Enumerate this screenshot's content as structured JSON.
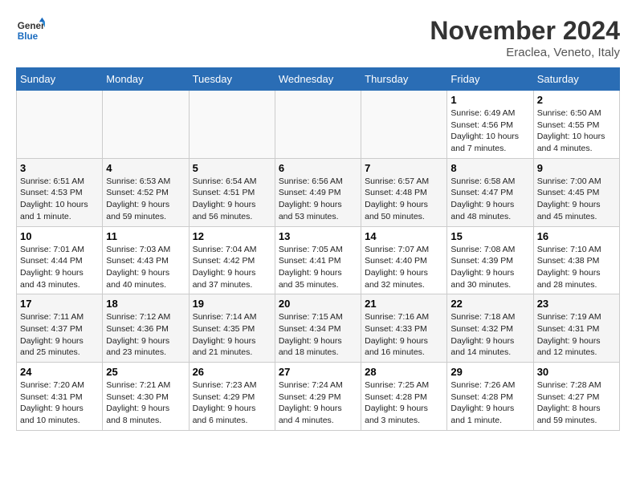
{
  "logo": {
    "line1": "General",
    "line2": "Blue"
  },
  "title": "November 2024",
  "location": "Eraclea, Veneto, Italy",
  "weekdays": [
    "Sunday",
    "Monday",
    "Tuesday",
    "Wednesday",
    "Thursday",
    "Friday",
    "Saturday"
  ],
  "weeks": [
    [
      {
        "day": "",
        "info": ""
      },
      {
        "day": "",
        "info": ""
      },
      {
        "day": "",
        "info": ""
      },
      {
        "day": "",
        "info": ""
      },
      {
        "day": "",
        "info": ""
      },
      {
        "day": "1",
        "info": "Sunrise: 6:49 AM\nSunset: 4:56 PM\nDaylight: 10 hours\nand 7 minutes."
      },
      {
        "day": "2",
        "info": "Sunrise: 6:50 AM\nSunset: 4:55 PM\nDaylight: 10 hours\nand 4 minutes."
      }
    ],
    [
      {
        "day": "3",
        "info": "Sunrise: 6:51 AM\nSunset: 4:53 PM\nDaylight: 10 hours\nand 1 minute."
      },
      {
        "day": "4",
        "info": "Sunrise: 6:53 AM\nSunset: 4:52 PM\nDaylight: 9 hours\nand 59 minutes."
      },
      {
        "day": "5",
        "info": "Sunrise: 6:54 AM\nSunset: 4:51 PM\nDaylight: 9 hours\nand 56 minutes."
      },
      {
        "day": "6",
        "info": "Sunrise: 6:56 AM\nSunset: 4:49 PM\nDaylight: 9 hours\nand 53 minutes."
      },
      {
        "day": "7",
        "info": "Sunrise: 6:57 AM\nSunset: 4:48 PM\nDaylight: 9 hours\nand 50 minutes."
      },
      {
        "day": "8",
        "info": "Sunrise: 6:58 AM\nSunset: 4:47 PM\nDaylight: 9 hours\nand 48 minutes."
      },
      {
        "day": "9",
        "info": "Sunrise: 7:00 AM\nSunset: 4:45 PM\nDaylight: 9 hours\nand 45 minutes."
      }
    ],
    [
      {
        "day": "10",
        "info": "Sunrise: 7:01 AM\nSunset: 4:44 PM\nDaylight: 9 hours\nand 43 minutes."
      },
      {
        "day": "11",
        "info": "Sunrise: 7:03 AM\nSunset: 4:43 PM\nDaylight: 9 hours\nand 40 minutes."
      },
      {
        "day": "12",
        "info": "Sunrise: 7:04 AM\nSunset: 4:42 PM\nDaylight: 9 hours\nand 37 minutes."
      },
      {
        "day": "13",
        "info": "Sunrise: 7:05 AM\nSunset: 4:41 PM\nDaylight: 9 hours\nand 35 minutes."
      },
      {
        "day": "14",
        "info": "Sunrise: 7:07 AM\nSunset: 4:40 PM\nDaylight: 9 hours\nand 32 minutes."
      },
      {
        "day": "15",
        "info": "Sunrise: 7:08 AM\nSunset: 4:39 PM\nDaylight: 9 hours\nand 30 minutes."
      },
      {
        "day": "16",
        "info": "Sunrise: 7:10 AM\nSunset: 4:38 PM\nDaylight: 9 hours\nand 28 minutes."
      }
    ],
    [
      {
        "day": "17",
        "info": "Sunrise: 7:11 AM\nSunset: 4:37 PM\nDaylight: 9 hours\nand 25 minutes."
      },
      {
        "day": "18",
        "info": "Sunrise: 7:12 AM\nSunset: 4:36 PM\nDaylight: 9 hours\nand 23 minutes."
      },
      {
        "day": "19",
        "info": "Sunrise: 7:14 AM\nSunset: 4:35 PM\nDaylight: 9 hours\nand 21 minutes."
      },
      {
        "day": "20",
        "info": "Sunrise: 7:15 AM\nSunset: 4:34 PM\nDaylight: 9 hours\nand 18 minutes."
      },
      {
        "day": "21",
        "info": "Sunrise: 7:16 AM\nSunset: 4:33 PM\nDaylight: 9 hours\nand 16 minutes."
      },
      {
        "day": "22",
        "info": "Sunrise: 7:18 AM\nSunset: 4:32 PM\nDaylight: 9 hours\nand 14 minutes."
      },
      {
        "day": "23",
        "info": "Sunrise: 7:19 AM\nSunset: 4:31 PM\nDaylight: 9 hours\nand 12 minutes."
      }
    ],
    [
      {
        "day": "24",
        "info": "Sunrise: 7:20 AM\nSunset: 4:31 PM\nDaylight: 9 hours\nand 10 minutes."
      },
      {
        "day": "25",
        "info": "Sunrise: 7:21 AM\nSunset: 4:30 PM\nDaylight: 9 hours\nand 8 minutes."
      },
      {
        "day": "26",
        "info": "Sunrise: 7:23 AM\nSunset: 4:29 PM\nDaylight: 9 hours\nand 6 minutes."
      },
      {
        "day": "27",
        "info": "Sunrise: 7:24 AM\nSunset: 4:29 PM\nDaylight: 9 hours\nand 4 minutes."
      },
      {
        "day": "28",
        "info": "Sunrise: 7:25 AM\nSunset: 4:28 PM\nDaylight: 9 hours\nand 3 minutes."
      },
      {
        "day": "29",
        "info": "Sunrise: 7:26 AM\nSunset: 4:28 PM\nDaylight: 9 hours\nand 1 minute."
      },
      {
        "day": "30",
        "info": "Sunrise: 7:28 AM\nSunset: 4:27 PM\nDaylight: 8 hours\nand 59 minutes."
      }
    ]
  ]
}
